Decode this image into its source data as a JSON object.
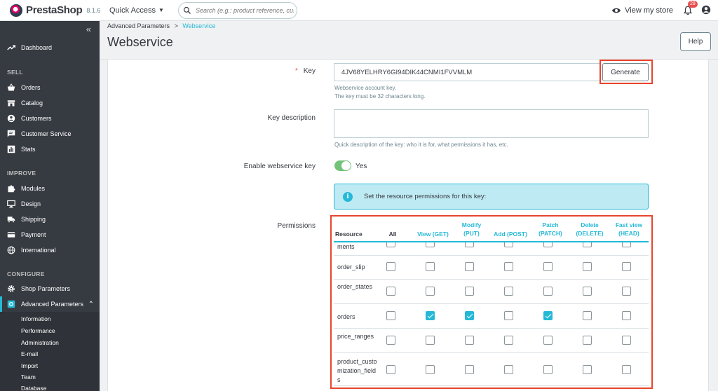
{
  "app": {
    "name": "PrestaShop",
    "version": "8.1.6"
  },
  "topbar": {
    "quick_access": "Quick Access",
    "search_placeholder": "Search (e.g.: product reference, custon",
    "view_store": "View my store",
    "notif_count": "28"
  },
  "sidebar": {
    "collapse": "«",
    "dashboard": "Dashboard",
    "sections": {
      "sell": "SELL",
      "improve": "IMPROVE",
      "configure": "CONFIGURE"
    },
    "sell_items": [
      "Orders",
      "Catalog",
      "Customers",
      "Customer Service",
      "Stats"
    ],
    "improve_items": [
      "Modules",
      "Design",
      "Shipping",
      "Payment",
      "International"
    ],
    "configure_items": [
      "Shop Parameters",
      "Advanced Parameters"
    ],
    "sub_items": [
      "Information",
      "Performance",
      "Administration",
      "E-mail",
      "Import",
      "Team",
      "Database"
    ]
  },
  "header": {
    "breadcrumb_parent": "Advanced Parameters",
    "breadcrumb_sep": ">",
    "breadcrumb_current": "Webservice",
    "title": "Webservice",
    "help": "Help"
  },
  "form": {
    "key_label": "Key",
    "key_required": "*",
    "key_value": "4JV68YELHRY6GI94DIK44CNMI1FVVMLM",
    "generate": "Generate",
    "key_help_1": "Webservice account key.",
    "key_help_2": "The key must be 32 characters long.",
    "desc_label": "Key description",
    "desc_help": "Quick description of the key: who it is for, what permissions it has, etc.",
    "enable_label": "Enable webservice key",
    "enable_value": "Yes",
    "alert_text": "Set the resource permissions for this key:",
    "permissions_label": "Permissions"
  },
  "permissions": {
    "headers": {
      "resource": "Resource",
      "all": "All",
      "view": [
        "View (GET)"
      ],
      "modify": [
        "Modify",
        "(PUT)"
      ],
      "add": [
        "Add (POST)"
      ],
      "patch": [
        "Patch",
        "(PATCH)"
      ],
      "delete": [
        "Delete",
        "(DELETE)"
      ],
      "fastview": [
        "Fast view",
        "(HEAD)"
      ]
    },
    "rows": [
      {
        "name": "ments",
        "checks": [
          false,
          false,
          false,
          false,
          false,
          false,
          false
        ]
      },
      {
        "name": "order_slip",
        "checks": [
          false,
          false,
          false,
          false,
          false,
          false,
          false
        ]
      },
      {
        "name": "order_states",
        "checks": [
          false,
          false,
          false,
          false,
          false,
          false,
          false
        ]
      },
      {
        "name": "orders",
        "checks": [
          false,
          true,
          true,
          false,
          true,
          false,
          false
        ]
      },
      {
        "name": "price_ranges",
        "checks": [
          false,
          false,
          false,
          false,
          false,
          false,
          false
        ]
      },
      {
        "name": "product_customization_fields",
        "checks": [
          false,
          false,
          false,
          false,
          false,
          false,
          false
        ]
      }
    ]
  }
}
